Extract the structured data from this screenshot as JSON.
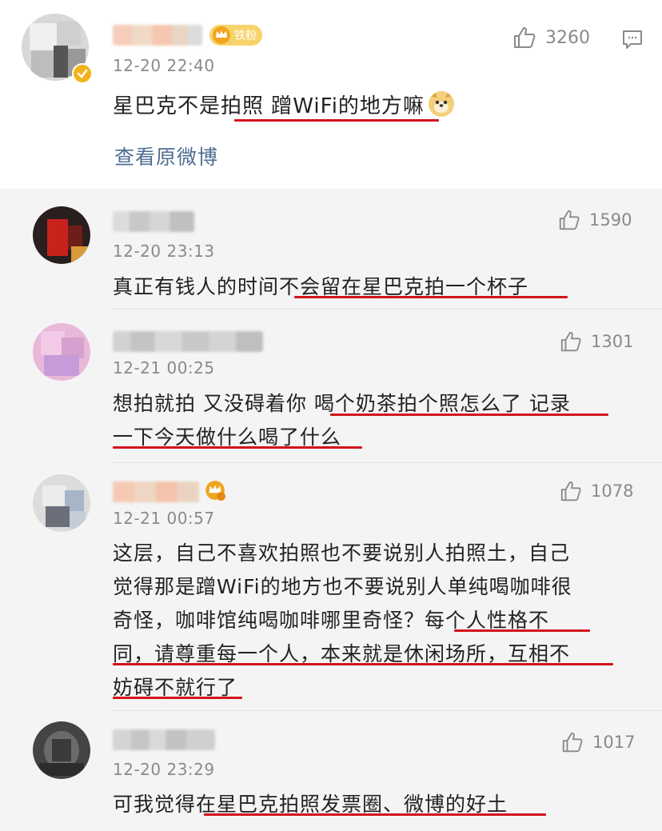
{
  "main_comment": {
    "time": "12-20 22:40",
    "likes": "3260",
    "text": "星巴克不是拍照 蹭WiFi的地方嘛",
    "badge": "铁粉",
    "view_original": "查看原微博"
  },
  "replies": [
    {
      "time": "12-20 23:13",
      "likes": "1590",
      "lines": [
        "真正有钱人的时间不会留在星巴克拍一个杯子"
      ]
    },
    {
      "time": "12-21 00:25",
      "likes": "1301",
      "lines": [
        "想拍就拍 又没碍着你 喝个奶茶拍个照怎么了 记录",
        "一下今天做什么喝了什么"
      ]
    },
    {
      "time": "12-21 00:57",
      "likes": "1078",
      "lines": [
        "这层，自己不喜欢拍照也不要说别人拍照土，自己",
        "觉得那是蹭WiFi的地方也不要说别人单纯喝咖啡很",
        "奇怪，咖啡馆纯喝咖啡哪里奇怪？每个人性格不",
        "同，请尊重每一个人，本来就是休闲场所，互相不",
        "妨碍不就行了"
      ]
    },
    {
      "time": "12-20 23:29",
      "likes": "1017",
      "lines": [
        "可我觉得在星巴克拍照发票圈、微博的好土"
      ]
    }
  ],
  "colors": {
    "underline": "#d3131c",
    "link": "#4e6d93",
    "meta": "#8a8a8a"
  },
  "icons": {
    "like": "thumbs-up-icon",
    "comment": "comment-icon",
    "emoji": "doge-emoji-icon",
    "verified": "verified-icon",
    "crown": "crown-badge-icon"
  }
}
